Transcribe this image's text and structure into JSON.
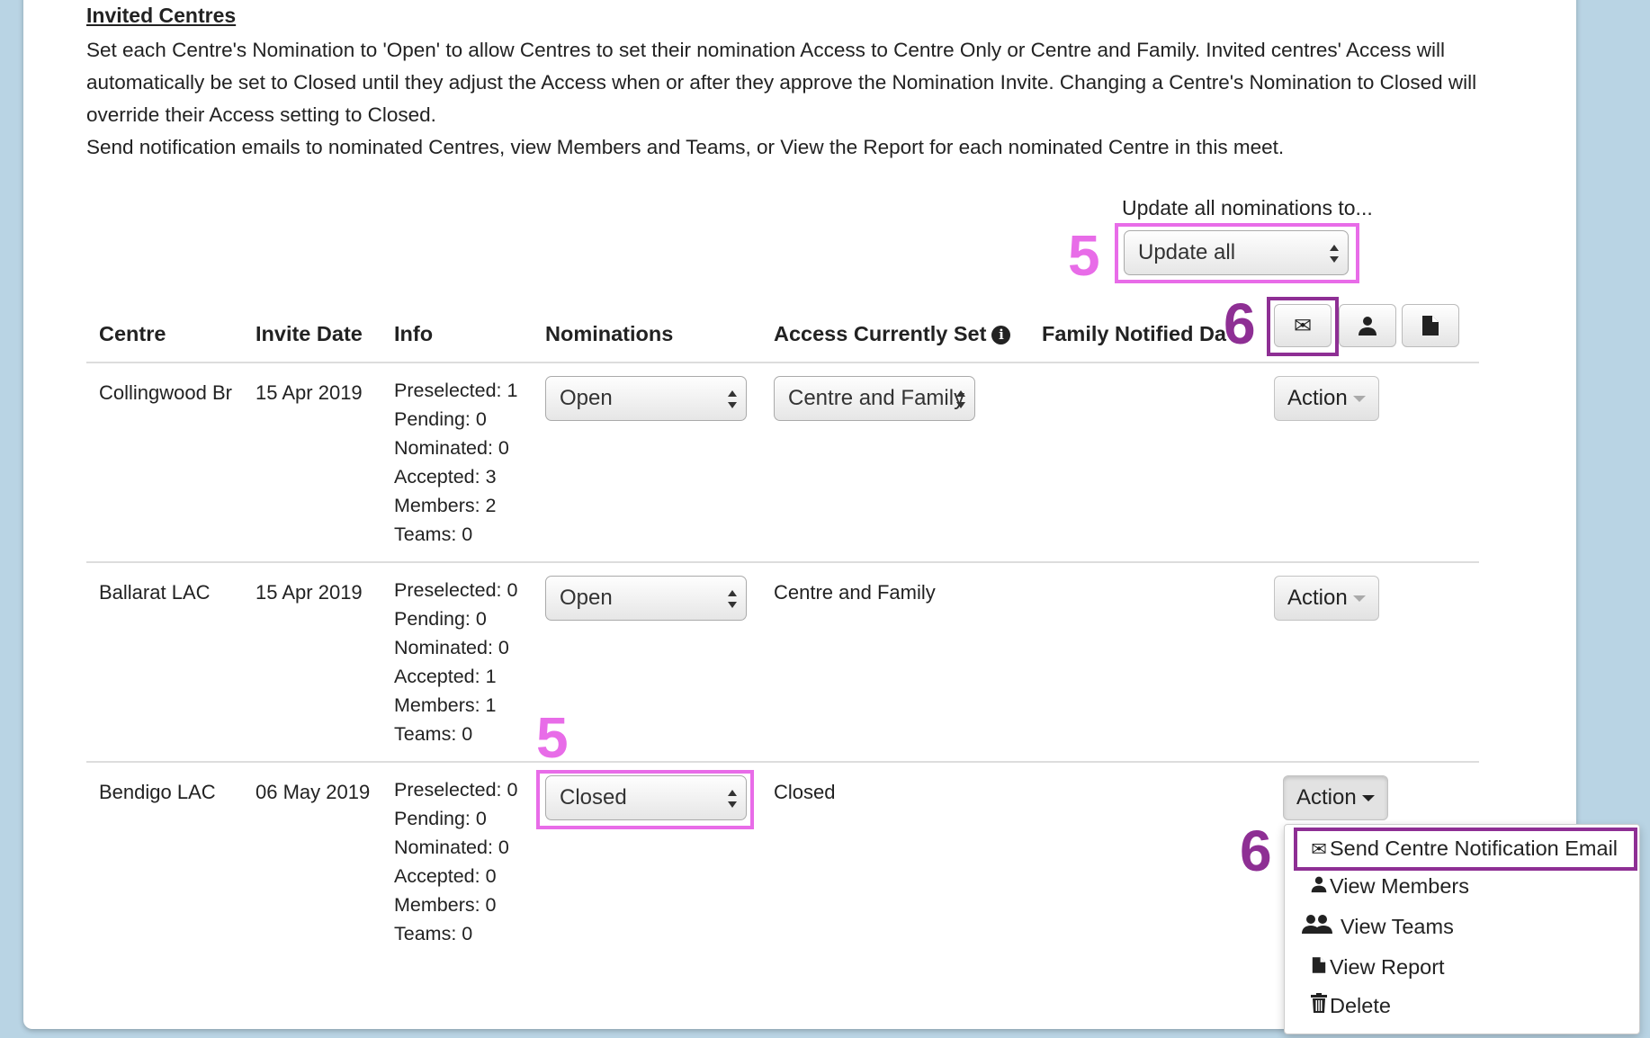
{
  "section": {
    "heading": "Invited Centres",
    "description_1": "Set each Centre's Nomination to 'Open' to allow Centres to set their nomination Access to Centre Only or Centre and Family. Invited centres' Access will automatically be set to Closed until they adjust the Access when or after they approve the Nomination Invite. Changing a Centre's Nomination to Closed will override their Access setting to Closed.",
    "description_2": "Send notification emails to nominated Centres, view Members and Teams, or View the Report for each nominated Centre in this meet."
  },
  "update_all": {
    "label": "Update all nominations to...",
    "selected": "Update all"
  },
  "annotations": {
    "step5": "5",
    "step6": "6"
  },
  "columns": {
    "centre": "Centre",
    "invite_date": "Invite Date",
    "info": "Info",
    "nominations": "Nominations",
    "access": "Access Currently Set",
    "family_notified": "Family Notified Da"
  },
  "header_icons": [
    "envelope-icon",
    "user-icon",
    "file-icon"
  ],
  "rows": [
    {
      "centre": "Collingwood Br",
      "invite_date": "15 Apr 2019",
      "info": [
        "Preselected: 1",
        "Pending: 0",
        "Nominated: 0",
        "Accepted: 3",
        "Members: 2",
        "Teams: 0"
      ],
      "nomination": "Open",
      "access": "Centre and Family",
      "action": "Action"
    },
    {
      "centre": "Ballarat LAC",
      "invite_date": "15 Apr 2019",
      "info": [
        "Preselected: 0",
        "Pending: 0",
        "Nominated: 0",
        "Accepted: 1",
        "Members: 1",
        "Teams: 0"
      ],
      "nomination": "Open",
      "access": "Centre and Family",
      "action": "Action"
    },
    {
      "centre": "Bendigo LAC",
      "invite_date": "06 May 2019",
      "info": [
        "Preselected: 0",
        "Pending: 0",
        "Nominated: 0",
        "Accepted: 0",
        "Members: 0",
        "Teams: 0"
      ],
      "nomination": "Closed",
      "access": "Closed",
      "action": "Action"
    }
  ],
  "action_menu": [
    {
      "icon": "envelope-icon",
      "label": "Send Centre Notification Email"
    },
    {
      "icon": "user-icon",
      "label": "View Members"
    },
    {
      "icon": "users-icon",
      "label": "View Teams"
    },
    {
      "icon": "file-icon",
      "label": "View Report"
    },
    {
      "icon": "trash-icon",
      "label": "Delete"
    }
  ],
  "colors": {
    "highlight_pink": "#e86ce8",
    "highlight_purple": "#8e2f94",
    "background": "#b9d4e4"
  }
}
